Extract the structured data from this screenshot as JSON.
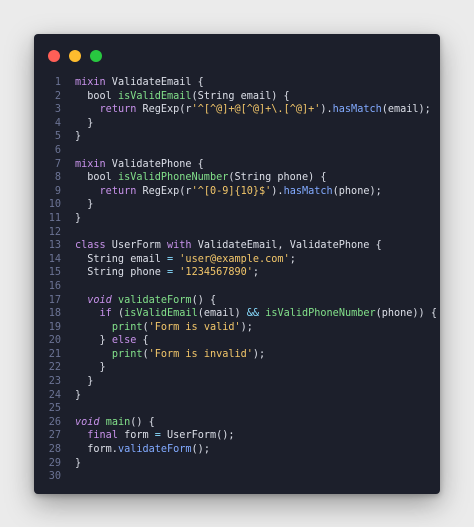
{
  "colors": {
    "background": "#ebebeb",
    "window": "#1c1f2b",
    "line_number": "#6b7394",
    "plain": "#dcdfe8",
    "keyword": "#c792ea",
    "function": "#82e08a",
    "string": "#f2c66a",
    "call": "#82aaff",
    "operator": "#89ddff",
    "dot_red": "#ff5f57",
    "dot_yellow": "#febc2e",
    "dot_green": "#28c840"
  },
  "window_controls": [
    "close-dot",
    "minimize-dot",
    "maximize-dot"
  ],
  "lines": [
    {
      "n": "1",
      "tokens": [
        {
          "t": "mixin",
          "c": "kw"
        },
        {
          "t": " ValidateEmail {",
          "c": "plain"
        }
      ]
    },
    {
      "n": "2",
      "tokens": [
        {
          "t": "  bool ",
          "c": "plain"
        },
        {
          "t": "isValidEmail",
          "c": "fn"
        },
        {
          "t": "(String email) {",
          "c": "plain"
        }
      ]
    },
    {
      "n": "3",
      "tokens": [
        {
          "t": "    ",
          "c": "plain"
        },
        {
          "t": "return",
          "c": "kw"
        },
        {
          "t": " RegExp(r",
          "c": "plain"
        },
        {
          "t": "'^[^@]+@[^@]+\\.[^@]+'",
          "c": "str"
        },
        {
          "t": ").",
          "c": "plain"
        },
        {
          "t": "hasMatch",
          "c": "call"
        },
        {
          "t": "(email);",
          "c": "plain"
        }
      ]
    },
    {
      "n": "4",
      "tokens": [
        {
          "t": "  }",
          "c": "plain"
        }
      ]
    },
    {
      "n": "5",
      "tokens": [
        {
          "t": "}",
          "c": "plain"
        }
      ]
    },
    {
      "n": "6",
      "tokens": []
    },
    {
      "n": "7",
      "tokens": [
        {
          "t": "mixin",
          "c": "kw"
        },
        {
          "t": " ValidatePhone {",
          "c": "plain"
        }
      ]
    },
    {
      "n": "8",
      "tokens": [
        {
          "t": "  bool ",
          "c": "plain"
        },
        {
          "t": "isValidPhoneNumber",
          "c": "fn"
        },
        {
          "t": "(String phone) {",
          "c": "plain"
        }
      ]
    },
    {
      "n": "9",
      "tokens": [
        {
          "t": "    ",
          "c": "plain"
        },
        {
          "t": "return",
          "c": "kw"
        },
        {
          "t": " RegExp(r",
          "c": "plain"
        },
        {
          "t": "'^[0-9]{10}$'",
          "c": "str"
        },
        {
          "t": ").",
          "c": "plain"
        },
        {
          "t": "hasMatch",
          "c": "call"
        },
        {
          "t": "(phone);",
          "c": "plain"
        }
      ]
    },
    {
      "n": "10",
      "tokens": [
        {
          "t": "  }",
          "c": "plain"
        }
      ]
    },
    {
      "n": "11",
      "tokens": [
        {
          "t": "}",
          "c": "plain"
        }
      ]
    },
    {
      "n": "12",
      "tokens": []
    },
    {
      "n": "13",
      "tokens": [
        {
          "t": "class",
          "c": "kw"
        },
        {
          "t": " UserForm ",
          "c": "plain"
        },
        {
          "t": "with",
          "c": "kw"
        },
        {
          "t": " ValidateEmail, ValidatePhone {",
          "c": "plain"
        }
      ]
    },
    {
      "n": "14",
      "tokens": [
        {
          "t": "  String email ",
          "c": "plain"
        },
        {
          "t": "=",
          "c": "op"
        },
        {
          "t": " ",
          "c": "plain"
        },
        {
          "t": "'user@example.com'",
          "c": "str"
        },
        {
          "t": ";",
          "c": "plain"
        }
      ]
    },
    {
      "n": "15",
      "tokens": [
        {
          "t": "  String phone ",
          "c": "plain"
        },
        {
          "t": "=",
          "c": "op"
        },
        {
          "t": " ",
          "c": "plain"
        },
        {
          "t": "'1234567890'",
          "c": "str"
        },
        {
          "t": ";",
          "c": "plain"
        }
      ]
    },
    {
      "n": "16",
      "tokens": []
    },
    {
      "n": "17",
      "tokens": [
        {
          "t": "  ",
          "c": "plain"
        },
        {
          "t": "void",
          "c": "kw it"
        },
        {
          "t": " ",
          "c": "plain"
        },
        {
          "t": "validateForm",
          "c": "fn"
        },
        {
          "t": "() {",
          "c": "plain"
        }
      ]
    },
    {
      "n": "18",
      "tokens": [
        {
          "t": "    ",
          "c": "plain"
        },
        {
          "t": "if",
          "c": "kw"
        },
        {
          "t": " (",
          "c": "plain"
        },
        {
          "t": "isValidEmail",
          "c": "fn"
        },
        {
          "t": "(email) ",
          "c": "plain"
        },
        {
          "t": "&&",
          "c": "op"
        },
        {
          "t": " ",
          "c": "plain"
        },
        {
          "t": "isValidPhoneNumber",
          "c": "fn"
        },
        {
          "t": "(phone)) {",
          "c": "plain"
        }
      ]
    },
    {
      "n": "19",
      "tokens": [
        {
          "t": "      ",
          "c": "plain"
        },
        {
          "t": "print",
          "c": "fn"
        },
        {
          "t": "(",
          "c": "plain"
        },
        {
          "t": "'Form is valid'",
          "c": "str"
        },
        {
          "t": ");",
          "c": "plain"
        }
      ]
    },
    {
      "n": "20",
      "tokens": [
        {
          "t": "    } ",
          "c": "plain"
        },
        {
          "t": "else",
          "c": "kw"
        },
        {
          "t": " {",
          "c": "plain"
        }
      ]
    },
    {
      "n": "21",
      "tokens": [
        {
          "t": "      ",
          "c": "plain"
        },
        {
          "t": "print",
          "c": "fn"
        },
        {
          "t": "(",
          "c": "plain"
        },
        {
          "t": "'Form is invalid'",
          "c": "str"
        },
        {
          "t": ");",
          "c": "plain"
        }
      ]
    },
    {
      "n": "22",
      "tokens": [
        {
          "t": "    }",
          "c": "plain"
        }
      ]
    },
    {
      "n": "23",
      "tokens": [
        {
          "t": "  }",
          "c": "plain"
        }
      ]
    },
    {
      "n": "24",
      "tokens": [
        {
          "t": "}",
          "c": "plain"
        }
      ]
    },
    {
      "n": "25",
      "tokens": []
    },
    {
      "n": "26",
      "tokens": [
        {
          "t": "void",
          "c": "kw it"
        },
        {
          "t": " ",
          "c": "plain"
        },
        {
          "t": "main",
          "c": "fn"
        },
        {
          "t": "() {",
          "c": "plain"
        }
      ]
    },
    {
      "n": "27",
      "tokens": [
        {
          "t": "  ",
          "c": "plain"
        },
        {
          "t": "final",
          "c": "kw"
        },
        {
          "t": " form ",
          "c": "plain"
        },
        {
          "t": "=",
          "c": "op"
        },
        {
          "t": " UserForm();",
          "c": "plain"
        }
      ]
    },
    {
      "n": "28",
      "tokens": [
        {
          "t": "  form.",
          "c": "plain"
        },
        {
          "t": "validateForm",
          "c": "call"
        },
        {
          "t": "();",
          "c": "plain"
        }
      ]
    },
    {
      "n": "29",
      "tokens": [
        {
          "t": "}",
          "c": "plain"
        }
      ]
    },
    {
      "n": "30",
      "tokens": []
    }
  ]
}
